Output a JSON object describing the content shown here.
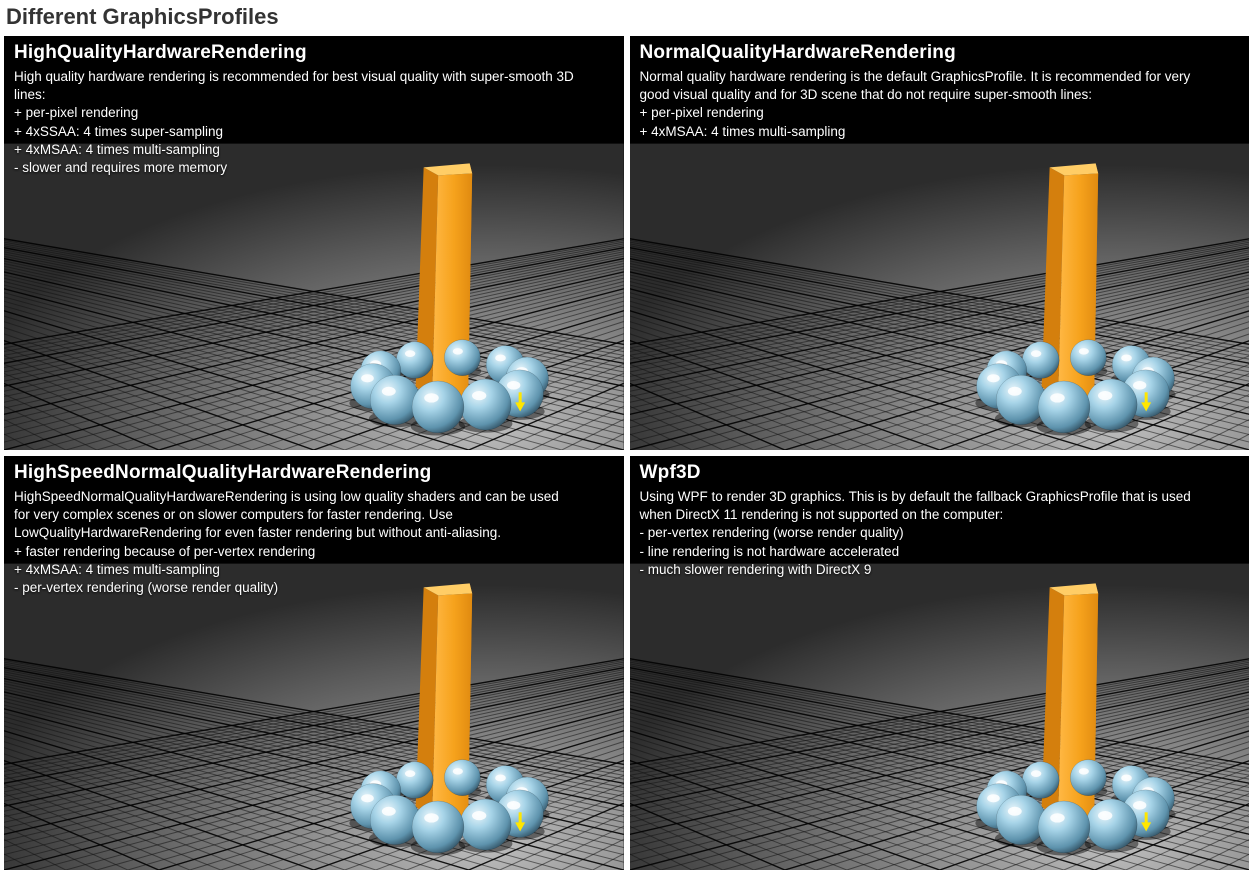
{
  "page_title": "Different GraphicsProfiles",
  "panels": {
    "hq": {
      "title": "HighQualityHardwareRendering",
      "desc": "High quality hardware rendering is recommended for best visual quality with super-smooth 3D lines:",
      "bullets": [
        "+ per-pixel rendering",
        "+ 4xSSAA: 4 times super-sampling",
        "+ 4xMSAA: 4 times multi-sampling",
        "- slower and requires more memory"
      ]
    },
    "nq": {
      "title": "NormalQualityHardwareRendering",
      "desc": "Normal quality hardware rendering is the default GraphicsProfile. It is recommended for very good visual quality and for 3D scene that do not require super-smooth lines:",
      "bullets": [
        "+ per-pixel rendering",
        "+ 4xMSAA: 4 times multi-sampling"
      ]
    },
    "hs": {
      "title": "HighSpeedNormalQualityHardwareRendering",
      "desc": "HighSpeedNormalQualityHardwareRendering is using low quality shaders and can be used for very complex scenes or on slower computers for faster rendering. Use LowQualityHardwareRendering for even faster rendering but without anti-aliasing.",
      "bullets": [
        "+ faster rendering because of per-vertex rendering",
        "+ 4xMSAA: 4 times multi-sampling",
        "- per-vertex rendering (worse render quality)"
      ]
    },
    "wpf": {
      "title": "Wpf3D",
      "desc": "Using WPF to render 3D graphics. This is by default the fallback GraphicsProfile that is used when DirectX 11 rendering is not supported on the computer:",
      "bullets": [
        "- per-vertex rendering (worse render quality)",
        "- line rendering is not hardware accelerated",
        "- much slower rendering with DirectX 9"
      ]
    }
  },
  "scene": {
    "pillar_color_front": "#f6a21c",
    "pillar_color_side": "#d47f0d",
    "pillar_color_top": "#ffcd66",
    "sphere_color": "#a7d4e8",
    "arrow_color": "#ffe600"
  }
}
